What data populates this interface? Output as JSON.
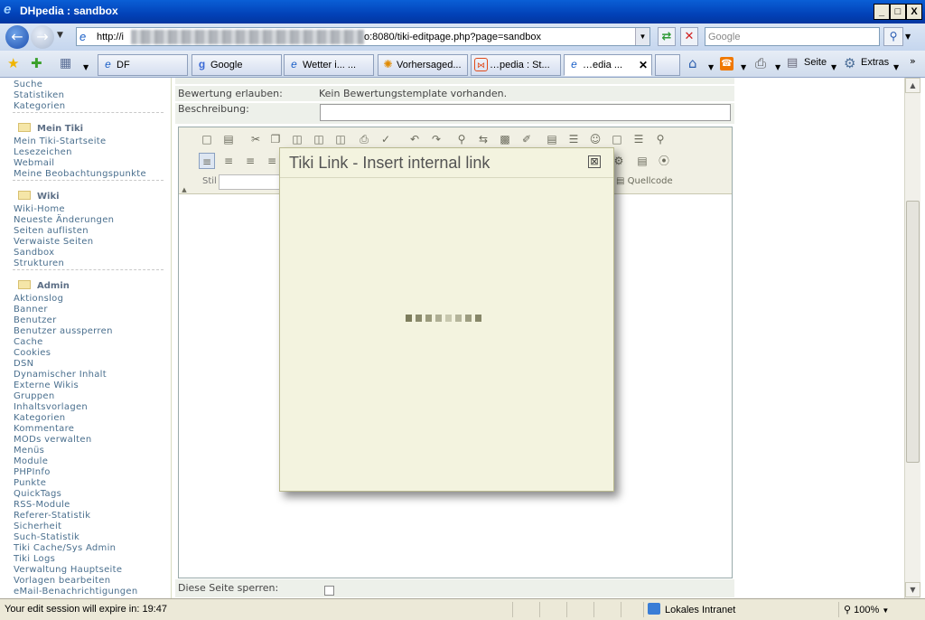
{
  "window": {
    "title": "DHpedia : sandbox",
    "buttons": {
      "minimize": "_",
      "maximize": "□",
      "close": "X"
    }
  },
  "address_bar": {
    "url_prefix": "http://i",
    "url_suffix": "o:8080/tiki-editpage.php?page=sandbox",
    "search_placeholder": "Google"
  },
  "tabs": [
    {
      "label": "DF",
      "icon": "ie-icon"
    },
    {
      "label": "Google",
      "icon": "google-icon"
    },
    {
      "label": "Wetter i...  ...",
      "icon": "ie-icon"
    },
    {
      "label": "Vorhersaged...",
      "icon": "orange-globe-icon"
    },
    {
      "label": "…pedia : St...",
      "icon": "tiki-icon"
    },
    {
      "label": "…edia ...",
      "icon": "ie-icon",
      "active": true
    }
  ],
  "command_bar": {
    "page_label": "Seite",
    "tools_label": "Extras"
  },
  "sidebar": {
    "top_items": [
      "Suche",
      "Statistiken",
      "Kategorien"
    ],
    "sections": [
      {
        "title": "Mein Tiki",
        "items": [
          "Mein Tiki-Startseite",
          "Lesezeichen",
          "Webmail",
          "Meine Beobachtungspunkte"
        ]
      },
      {
        "title": "Wiki",
        "items": [
          "Wiki-Home",
          "Neueste Änderungen",
          "Seiten auflisten",
          "Verwaiste Seiten",
          "Sandbox",
          "Strukturen"
        ]
      },
      {
        "title": "Admin",
        "items": [
          "Aktionslog",
          "Banner",
          "Benutzer",
          "Benutzer aussperren",
          "Cache",
          "Cookies",
          "DSN",
          "Dynamischer Inhalt",
          "Externe Wikis",
          "Gruppen",
          "Inhaltsvorlagen",
          "Kategorien",
          "Kommentare",
          "MODs verwalten",
          "Menüs",
          "Module",
          "PHPInfo",
          "Punkte",
          "QuickTags",
          "RSS-Module",
          "Referer-Statistik",
          "Sicherheit",
          "Such-Statistik",
          "Tiki Cache/Sys Admin",
          "Tiki Logs",
          "Verwaltung Hauptseite",
          "Vorlagen bearbeiten",
          "eMail-Benachrichtigungen"
        ]
      }
    ]
  },
  "form": {
    "rating_label": "Bewertung erlauben:",
    "rating_value": "Kein Bewertungstemplate vorhanden.",
    "description_label": "Beschreibung:",
    "lock_label": "Diese Seite sperren:"
  },
  "editor": {
    "style_label": "Stil",
    "source_label": "Quellcode"
  },
  "modal": {
    "title": "Tiki Link - Insert internal link",
    "close_symbol": "⊠",
    "spinner_colors": [
      "#7c7c5c",
      "#8a8a6c",
      "#9a9a7c",
      "#aeae94",
      "#c7c7ae",
      "#b4b49a",
      "#9c9c80",
      "#868668"
    ]
  },
  "status_bar": {
    "message": "Your edit session will expire in:  19:47",
    "zone": "Lokales Intranet",
    "zoom": "100%"
  }
}
